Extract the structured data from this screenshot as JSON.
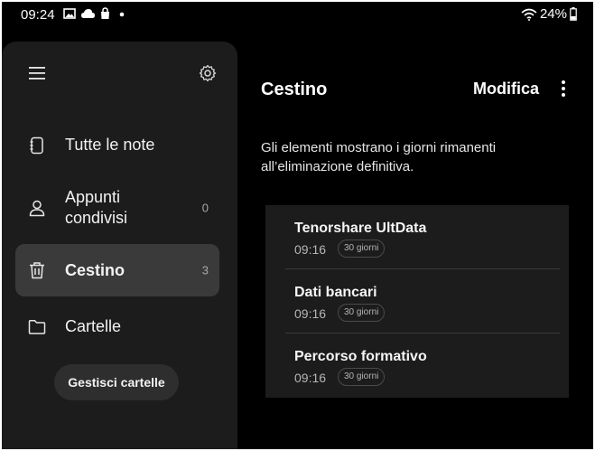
{
  "status_bar": {
    "time": "09:24",
    "left_icons": [
      "image-icon",
      "cloud-icon",
      "shopping-bag-icon",
      "dot-icon"
    ],
    "battery_percent": "24%",
    "right_icons": [
      "wifi-icon",
      "battery-icon"
    ]
  },
  "sidebar": {
    "menu_icon": "hamburger-menu-icon",
    "settings_icon": "gear-icon",
    "items": [
      {
        "label": "Tutte le note",
        "icon": "notebook-icon",
        "count": ""
      },
      {
        "label": "Appunti condivisi",
        "icon": "person-icon",
        "count": "0"
      },
      {
        "label": "Cestino",
        "icon": "trash-icon",
        "count": "3",
        "active": true
      },
      {
        "label": "Cartelle",
        "icon": "folder-icon",
        "count": ""
      }
    ],
    "manage_folders_label": "Gestisci cartelle"
  },
  "main": {
    "title": "Cestino",
    "edit_label": "Modifica",
    "more_icon": "more-vertical-icon",
    "info_text": "Gli elementi mostrano i giorni rimanenti all’eliminazione definitiva.",
    "notes": [
      {
        "title": "Tenorshare UltData",
        "time": "09:16",
        "days_left": "30 giorni"
      },
      {
        "title": "Dati bancari",
        "time": "09:16",
        "days_left": "30 giorni"
      },
      {
        "title": "Percorso formativo",
        "time": "09:16",
        "days_left": "30 giorni"
      }
    ]
  },
  "colors": {
    "background": "#000000",
    "sidebar": "#1c1c1c",
    "active_item": "#3a3a3a",
    "text": "#ffffff"
  }
}
